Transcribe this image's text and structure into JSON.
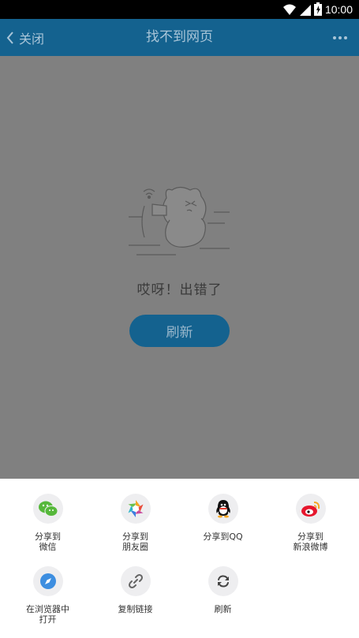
{
  "status_bar": {
    "time": "10:00"
  },
  "nav": {
    "back_label": "关闭",
    "title": "找不到网页"
  },
  "content": {
    "error_message": "哎呀！出错了",
    "refresh_button": "刷新"
  },
  "share_sheet": {
    "items": [
      {
        "label_line1": "分享到",
        "label_line2": "微信",
        "icon": "wechat-icon",
        "color": "#56b83b"
      },
      {
        "label_line1": "分享到",
        "label_line2": "朋友圈",
        "icon": "moments-icon",
        "color": "#f5a623"
      },
      {
        "label_line1": "分享到QQ",
        "label_line2": "",
        "icon": "qq-icon",
        "color": "#000000"
      },
      {
        "label_line1": "分享到",
        "label_line2": "新浪微博",
        "icon": "weibo-icon",
        "color": "#e6162d"
      },
      {
        "label_line1": "在浏览器中",
        "label_line2": "打开",
        "icon": "compass-icon",
        "color": "#3d8ee0"
      },
      {
        "label_line1": "复制链接",
        "label_line2": "",
        "icon": "link-icon",
        "color": "#666666"
      },
      {
        "label_line1": "刷新",
        "label_line2": "",
        "icon": "refresh-icon",
        "color": "#444444"
      }
    ]
  }
}
